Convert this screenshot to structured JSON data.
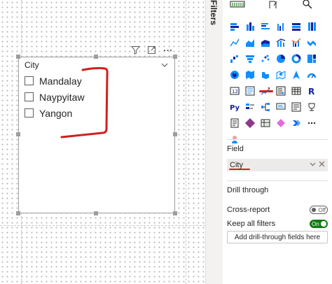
{
  "canvas": {
    "slicer": {
      "title": "City",
      "items": [
        "Mandalay",
        "Naypyitaw",
        "Yangon"
      ]
    },
    "toolbar_icons": [
      "filter-icon",
      "focus-mode-icon",
      "more-options-icon"
    ]
  },
  "filters_pane": {
    "label": "Filters"
  },
  "viz_pane": {
    "tabs": [
      "build-visual-icon",
      "format-visual-icon",
      "analytics-icon"
    ],
    "field_section": {
      "title": "Field",
      "value": "City"
    },
    "drill_through": {
      "title": "Drill through",
      "cross_report_label": "Cross-report",
      "cross_report_state": "Off",
      "keep_filters_label": "Keep all filters",
      "keep_filters_state": "On",
      "add_label": "Add drill-through fields here"
    },
    "annotation_color": "#d11f1f"
  }
}
